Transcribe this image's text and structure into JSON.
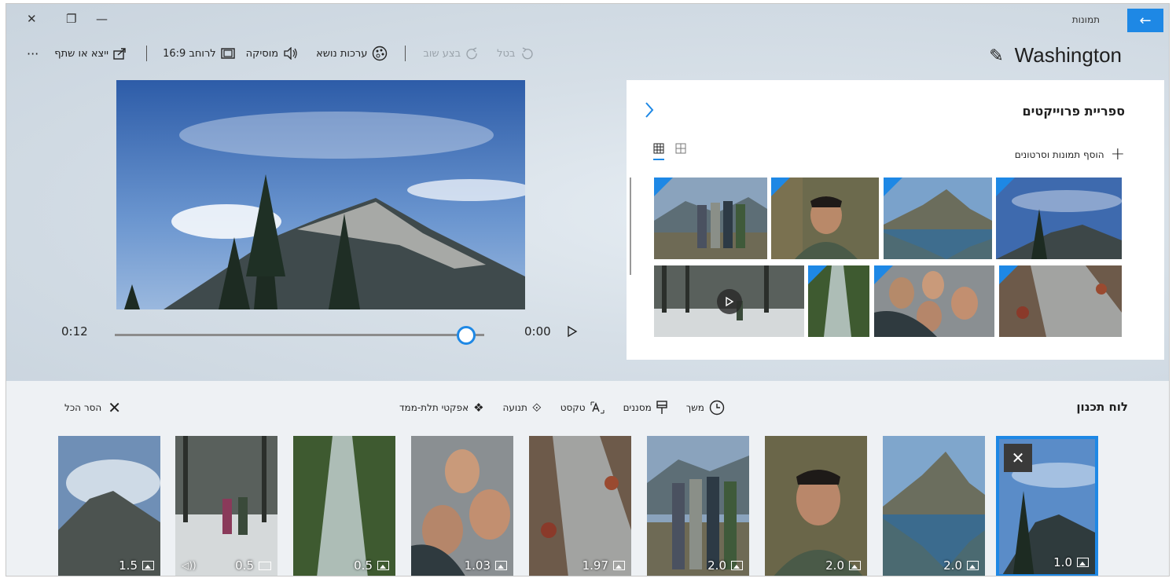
{
  "window": {
    "app_name": "תמונות",
    "back_glyph": "←",
    "close_glyph": "✕",
    "restore_glyph": "❐",
    "minimize_glyph": "—"
  },
  "project": {
    "title": "Washington",
    "edit_icon": "✎"
  },
  "toolbar": {
    "more": "···",
    "share_label": "ייצא או שתף",
    "aspect_label": "16:9 לרוחב",
    "music_label": "מוסיקה",
    "theme_label": "ערכות נושא",
    "redo_label": "בצע שוב",
    "undo_label": "בטל"
  },
  "player": {
    "current_time": "0:12",
    "start_time": "0:00",
    "progress": 0.95
  },
  "library": {
    "title": "ספריית פרוייקטים",
    "add_label": "הוסף תמונות וסרטונים"
  },
  "storyboard": {
    "title": "לוח תכנון",
    "remove_all_label": "הסר הכל",
    "tools": {
      "duration": "משך",
      "filters": "מסננים",
      "text": "טקסט",
      "motion": "תנועה",
      "effects_3d": "אפקטי תלת-ממד"
    },
    "cards": [
      {
        "duration": "1.0",
        "kind": "image"
      },
      {
        "duration": "2.0",
        "kind": "image"
      },
      {
        "duration": "2.0",
        "kind": "image"
      },
      {
        "duration": "2.0",
        "kind": "image"
      },
      {
        "duration": "1.97",
        "kind": "image"
      },
      {
        "duration": "1.03",
        "kind": "image"
      },
      {
        "duration": "0.5",
        "kind": "image"
      },
      {
        "duration": "0.5",
        "kind": "video"
      },
      {
        "duration": "1.5",
        "kind": "image"
      }
    ]
  }
}
